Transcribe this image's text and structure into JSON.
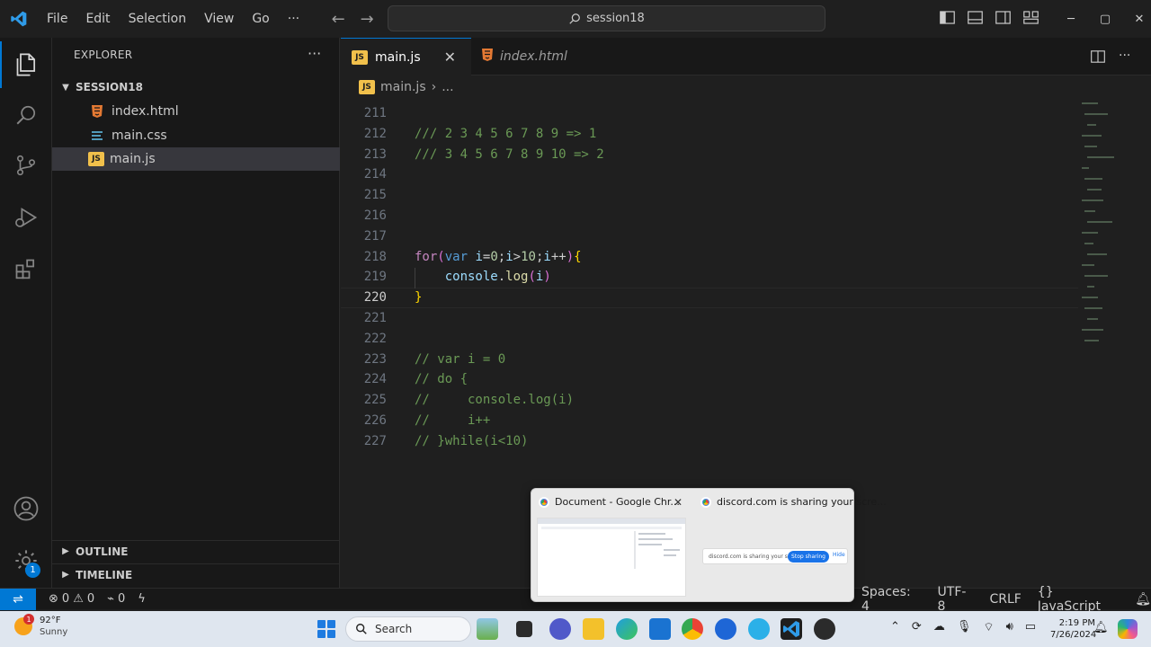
{
  "titlebar": {
    "menu": [
      "File",
      "Edit",
      "Selection",
      "View",
      "Go"
    ],
    "more": "···",
    "command_center": "session18"
  },
  "sidebar": {
    "header": "EXPLORER",
    "more": "···",
    "folder": "SESSION18",
    "files": [
      {
        "name": "index.html",
        "icon": "html-file-icon"
      },
      {
        "name": "main.css",
        "icon": "css-file-icon"
      },
      {
        "name": "main.js",
        "icon": "js-file-icon",
        "selected": true
      }
    ],
    "sections": [
      "OUTLINE",
      "TIMELINE"
    ]
  },
  "tabs": [
    {
      "label": "main.js",
      "active": true,
      "icon_text": "JS"
    },
    {
      "label": "index.html",
      "active": false
    }
  ],
  "breadcrumb": {
    "file": "main.js",
    "rest": "..."
  },
  "editor": {
    "current_line": 220,
    "lines": [
      {
        "n": "211",
        "tokens": []
      },
      {
        "n": "212",
        "tokens": [
          {
            "t": "/// 2 3 4 5 6 7 8 9 => 1",
            "c": "c-comment"
          }
        ]
      },
      {
        "n": "213",
        "tokens": [
          {
            "t": "/// 3 4 5 6 7 8 9 10 => 2",
            "c": "c-comment"
          }
        ]
      },
      {
        "n": "214",
        "tokens": []
      },
      {
        "n": "215",
        "tokens": []
      },
      {
        "n": "216",
        "tokens": []
      },
      {
        "n": "217",
        "tokens": []
      },
      {
        "n": "218",
        "tokens": [
          {
            "t": "for",
            "c": "c-kw"
          },
          {
            "t": "(",
            "c": "c-paren"
          },
          {
            "t": "var",
            "c": "c-var"
          },
          {
            "t": " ",
            "c": "c-punc"
          },
          {
            "t": "i",
            "c": "c-id"
          },
          {
            "t": "=",
            "c": "c-punc"
          },
          {
            "t": "0",
            "c": "c-num"
          },
          {
            "t": ";",
            "c": "c-punc"
          },
          {
            "t": "i",
            "c": "c-id"
          },
          {
            "t": ">",
            "c": "c-punc"
          },
          {
            "t": "10",
            "c": "c-num"
          },
          {
            "t": ";",
            "c": "c-punc"
          },
          {
            "t": "i",
            "c": "c-id"
          },
          {
            "t": "++",
            "c": "c-punc"
          },
          {
            "t": ")",
            "c": "c-paren"
          },
          {
            "t": "{",
            "c": "c-brace"
          }
        ]
      },
      {
        "n": "219",
        "tokens": [
          {
            "t": "    ",
            "c": "c-punc"
          },
          {
            "t": "console",
            "c": "c-id"
          },
          {
            "t": ".",
            "c": "c-punc"
          },
          {
            "t": "log",
            "c": "c-fn"
          },
          {
            "t": "(",
            "c": "c-paren"
          },
          {
            "t": "i",
            "c": "c-id"
          },
          {
            "t": ")",
            "c": "c-paren"
          }
        ]
      },
      {
        "n": "220",
        "tokens": [
          {
            "t": "}",
            "c": "c-brace"
          }
        ]
      },
      {
        "n": "221",
        "tokens": []
      },
      {
        "n": "222",
        "tokens": []
      },
      {
        "n": "223",
        "tokens": [
          {
            "t": "// var i = 0",
            "c": "c-comment"
          }
        ]
      },
      {
        "n": "224",
        "tokens": [
          {
            "t": "// do {",
            "c": "c-comment"
          }
        ]
      },
      {
        "n": "225",
        "tokens": [
          {
            "t": "//     console.log(i)",
            "c": "c-comment"
          }
        ]
      },
      {
        "n": "226",
        "tokens": [
          {
            "t": "//     i++",
            "c": "c-comment"
          }
        ]
      },
      {
        "n": "227",
        "tokens": [
          {
            "t": "// }while(i<10)",
            "c": "c-comment"
          }
        ]
      }
    ]
  },
  "statusbar": {
    "errors": "0",
    "warnings": "0",
    "ports": "0",
    "spaces": "Spaces: 4",
    "encoding": "UTF-8",
    "eol": "CRLF",
    "language": "JavaScript",
    "language_icon": "{}"
  },
  "popup": {
    "thumb1_title": "Document - Google Chr...",
    "thumb2_title": "discord.com is sharing your scre...",
    "share_text": "discord.com is sharing your screen.",
    "stop_label": "Stop sharing",
    "hide_label": "Hide"
  },
  "taskbar": {
    "weather_temp": "92°F",
    "weather_desc": "Sunny",
    "weather_badge": "1",
    "search_label": "Search",
    "time": "2:19 PM",
    "date": "7/26/2024"
  },
  "activity_badge": "1",
  "colors": {
    "accent": "#0078d4",
    "editor_bg": "#1f1f1f",
    "comment": "#6a9955",
    "keyword": "#c586c0"
  }
}
